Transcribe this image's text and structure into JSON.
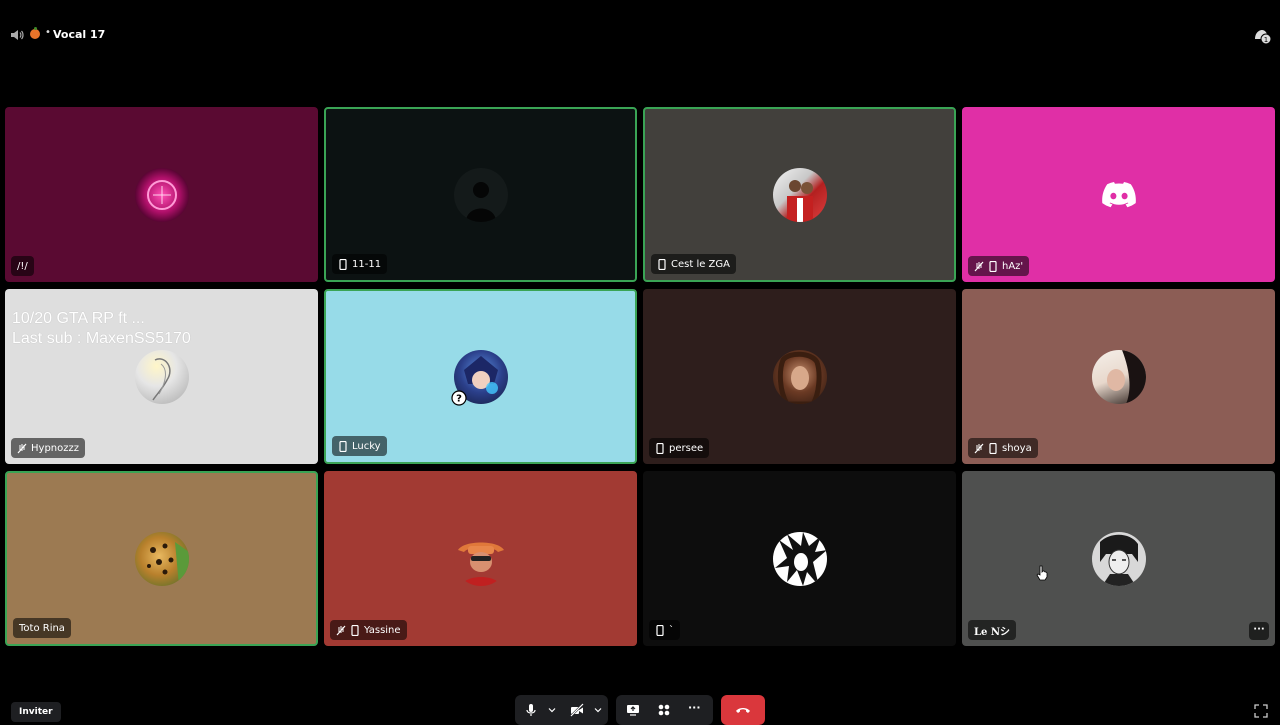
{
  "header": {
    "channel_name": "Vocal 17",
    "separator": "•"
  },
  "tiles": [
    {
      "name": "/!/",
      "bg": "#5a0a32",
      "speaking": false
    },
    {
      "name": "11-11",
      "bg": "#0c1212",
      "speaking": true
    },
    {
      "name": "Cest le ZGA",
      "bg": "#42403c",
      "speaking": true
    },
    {
      "name": "hAz'",
      "bg": "#e02fa6",
      "speaking": false
    },
    {
      "name": "Hypnozzz",
      "bg": "#dedede",
      "speaking": false,
      "overlay_line1": "10/20 GTA RP ft ...",
      "overlay_line2": "Last sub : MaxenSS5170"
    },
    {
      "name": "Lucky",
      "bg": "#97dbe8",
      "speaking": true
    },
    {
      "name": "persee",
      "bg": "#2e1e1c",
      "speaking": false
    },
    {
      "name": "shoya",
      "bg": "#8c5d55",
      "speaking": false
    },
    {
      "name": "Toto Rina",
      "bg": "#9c7a52",
      "speaking": true
    },
    {
      "name": "Yassine",
      "bg": "#a23a33",
      "speaking": false
    },
    {
      "name": "`",
      "bg": "#0d0d0d",
      "speaking": false
    },
    {
      "name": "Le Nシ",
      "bg": "#4f504f",
      "speaking": false
    }
  ],
  "controls": {
    "invite_label": "Inviter",
    "more_label": "···",
    "tile_more_label": "···"
  },
  "colors": {
    "speaking_border": "#3aa455",
    "disconnect": "#da373c",
    "control_bg": "#1e1f22"
  },
  "icons": [
    "speaker-icon",
    "activity-icon",
    "mobile-icon",
    "deafened-icon",
    "microphone-icon",
    "camera-off-icon",
    "screen-share-icon",
    "activities-icon",
    "phone-hangup-icon",
    "fullscreen-icon",
    "discord-icon"
  ]
}
